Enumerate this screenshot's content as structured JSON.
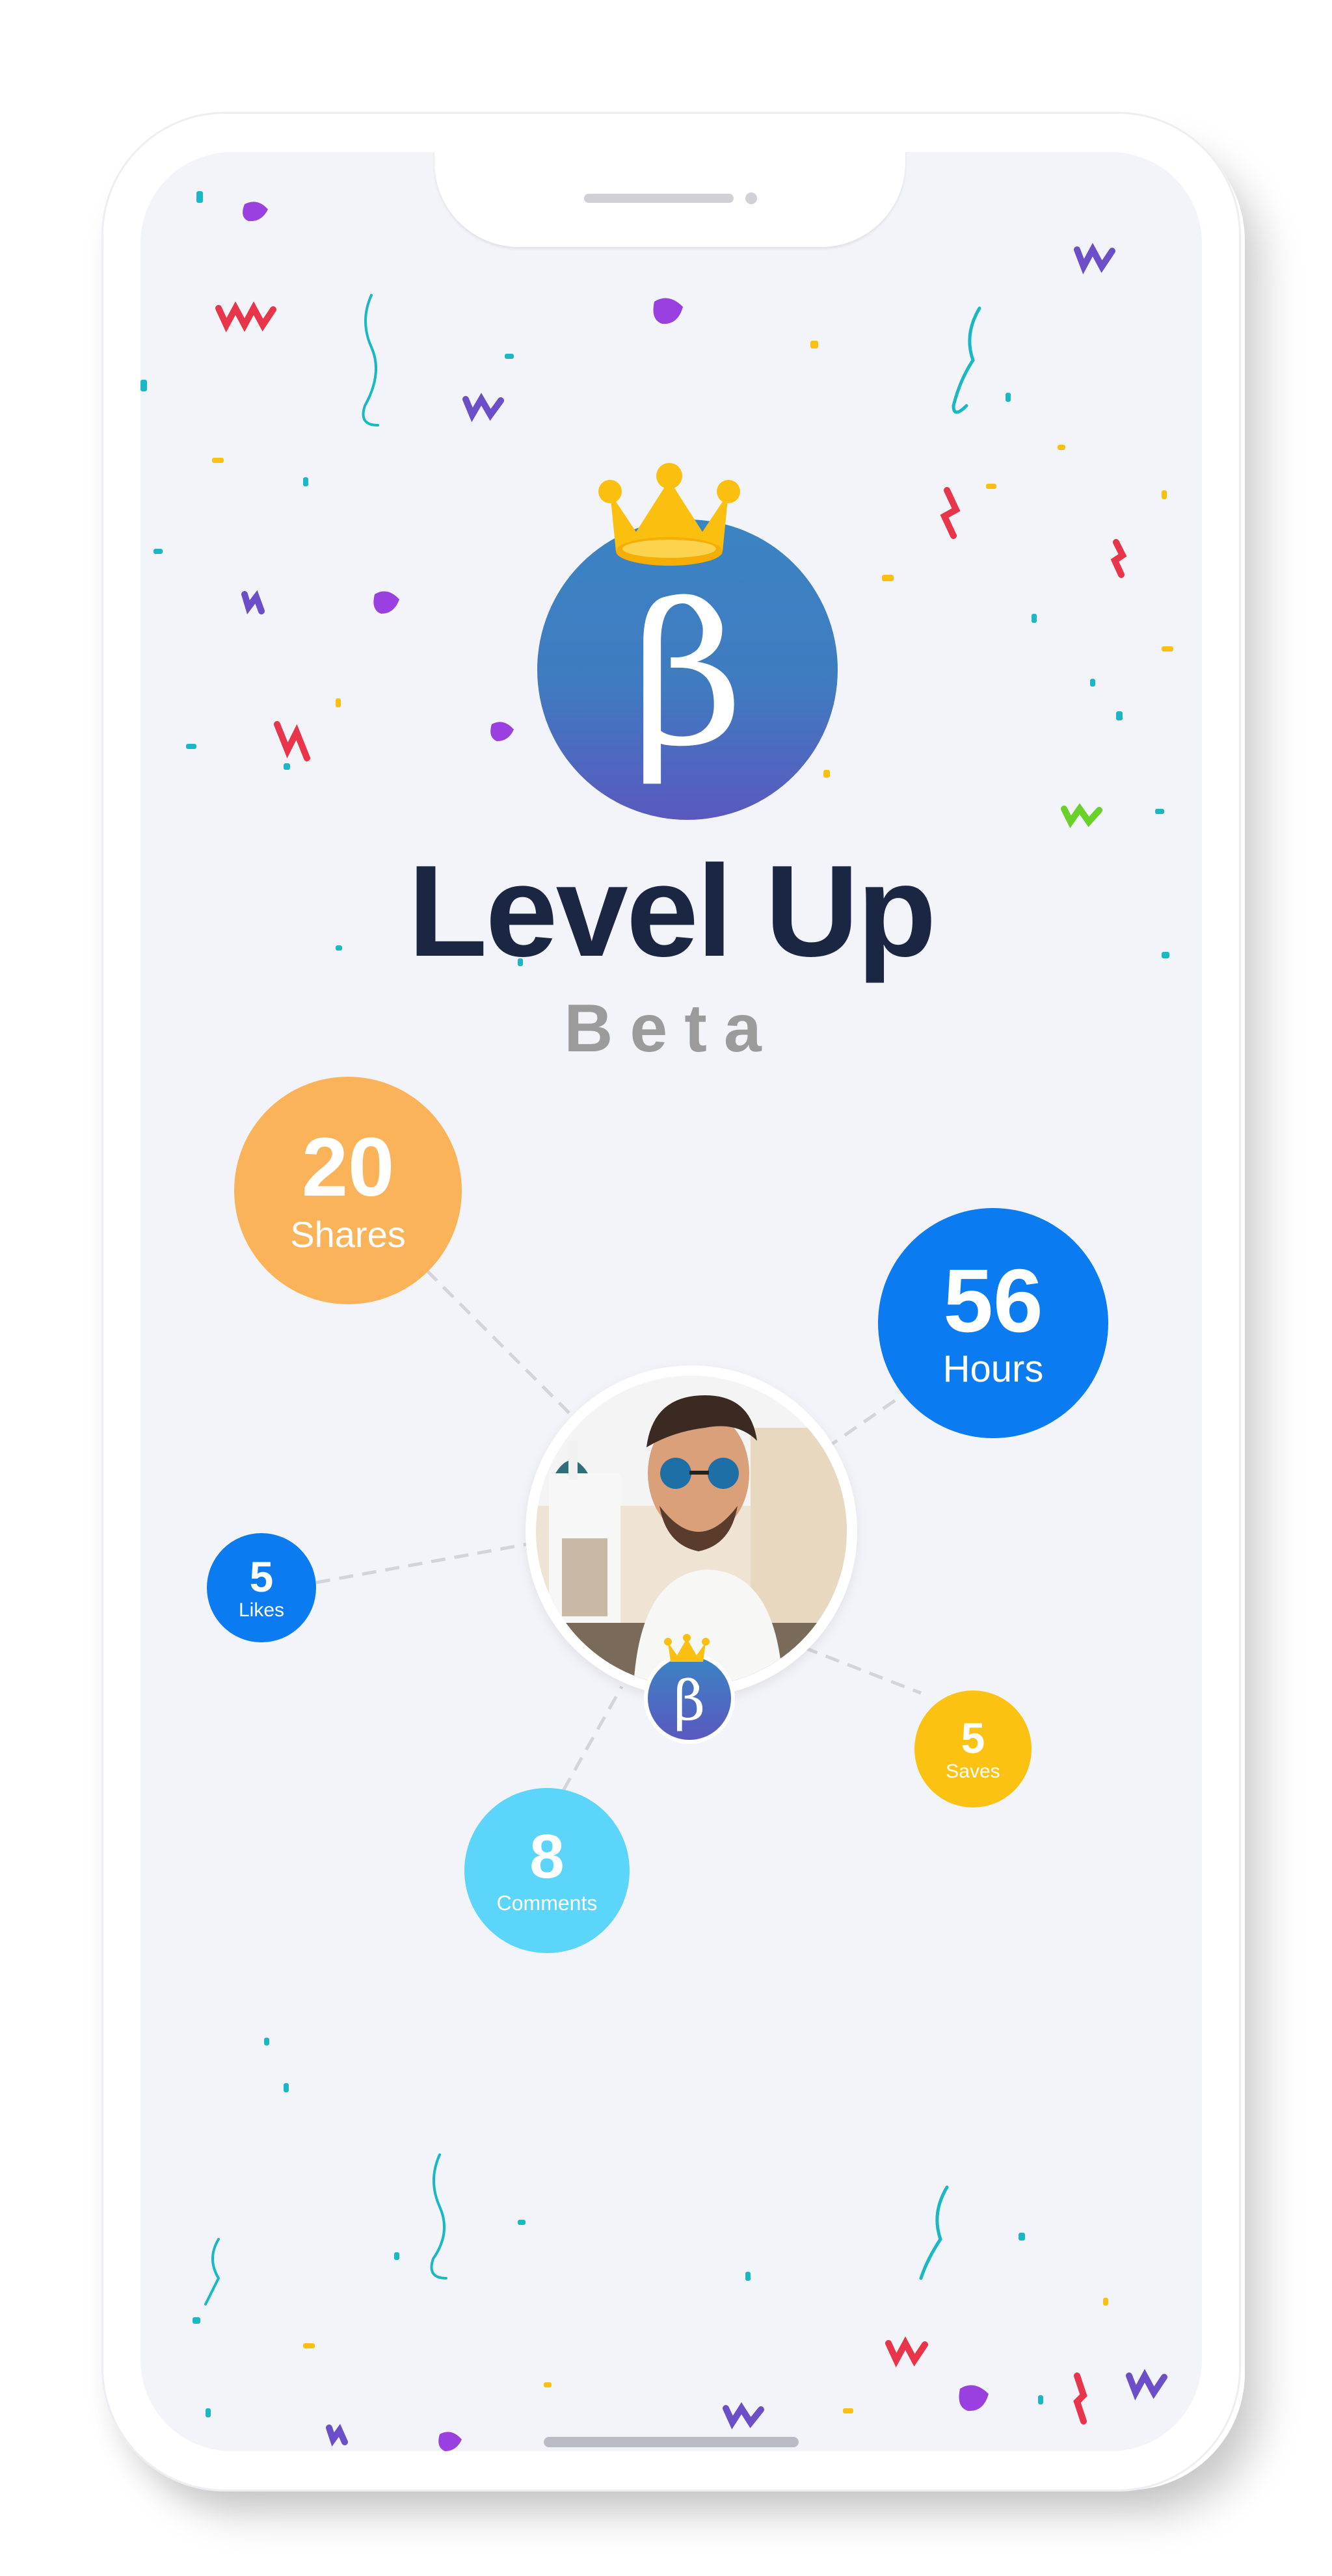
{
  "header": {
    "title": "Level Up",
    "subtitle": "Beta",
    "badge_glyph": "β"
  },
  "stats": {
    "shares": {
      "value": "20",
      "label": "Shares",
      "color": "#fbb35a"
    },
    "hours": {
      "value": "56",
      "label": "Hours",
      "color": "#0a7bf1"
    },
    "likes": {
      "value": "5",
      "label": "Likes",
      "color": "#0a7bf1"
    },
    "saves": {
      "value": "5",
      "label": "Saves",
      "color": "#fcc212"
    },
    "comments": {
      "value": "8",
      "label": "Comments",
      "color": "#5bd5fa"
    }
  },
  "profile": {
    "avatar_icon": "user-avatar-photo",
    "badge_glyph": "β"
  },
  "colors": {
    "title": "#1b2643",
    "subtitle": "#9b9b9b",
    "background": "#f3f4f9",
    "crown": "#fbbf0f"
  }
}
